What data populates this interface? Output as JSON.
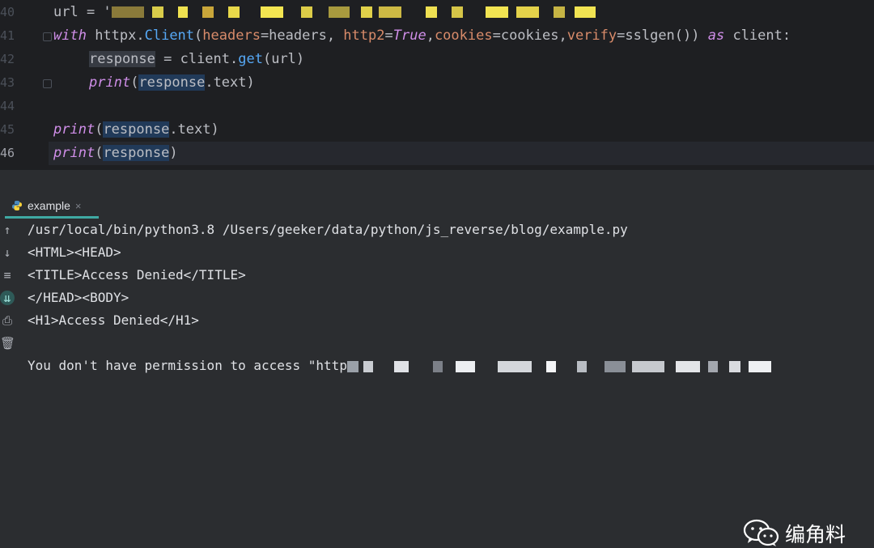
{
  "editor": {
    "lines": [
      {
        "num": "40",
        "prefix": "url = '"
      },
      {
        "num": "41"
      },
      {
        "num": "42"
      },
      {
        "num": "43"
      },
      {
        "num": "44"
      },
      {
        "num": "45"
      },
      {
        "num": "46"
      }
    ],
    "tokens": {
      "with": "with",
      "httpx": " httpx.",
      "client_cls": "Client",
      "paren_open": "(",
      "headers_kw": "headers",
      "headers_val": "=headers, ",
      "http2_kw": "http2",
      "eq": "=",
      "true": "True",
      "comma": ",",
      "cookies_kw": "cookies",
      "cookies_val": "=cookies,",
      "verify_kw": "verify",
      "verify_val": "=sslgen()) ",
      "as": "as",
      "client_tail": " client:",
      "response": "response",
      "assign": " = client.",
      "get": "get",
      "get_args": "(url)",
      "print": "print",
      "text_tail": ".text)",
      "close_paren": ")"
    }
  },
  "run_panel": {
    "tab_label": "example",
    "close_glyph": "×",
    "output": [
      "/usr/local/bin/python3.8 /Users/geeker/data/python/js_reverse/blog/example.py",
      "<HTML><HEAD>",
      "<TITLE>Access Denied</TITLE>",
      "</HEAD><BODY>",
      "<H1>Access Denied</H1>",
      "",
      "You don't have permission to access \"http"
    ],
    "toolbar_icons": [
      "arrow-up-icon",
      "arrow-down-icon",
      "soft-wrap-icon",
      "scroll-to-end-icon",
      "print-icon",
      "trash-icon"
    ]
  },
  "watermark": {
    "text": "编角料",
    "icon": "wechat-icon"
  },
  "colors": {
    "editor_bg": "#1e1f22",
    "panel_bg": "#2b2d30",
    "keyword": "#cf8ee8",
    "function": "#56a8f5",
    "parameter": "#d88b6a",
    "tab_accent": "#3fa9a3"
  }
}
